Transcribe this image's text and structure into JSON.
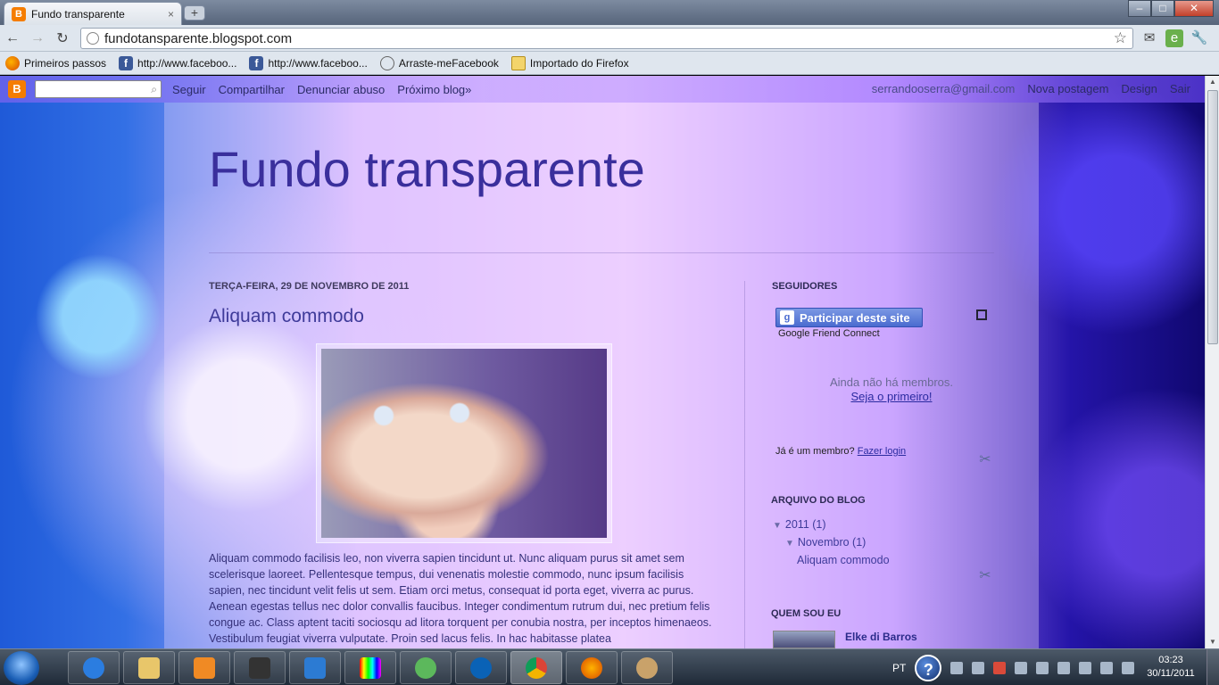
{
  "browser": {
    "tab_title": "Fundo transparente",
    "tab_close": "×",
    "new_tab": "+",
    "url": "fundotansparente.blogspot.com",
    "bookmarks": [
      {
        "label": "Primeiros passos",
        "icon": "firefox-icon"
      },
      {
        "label": "http://www.faceboo...",
        "icon": "facebook-icon"
      },
      {
        "label": "http://www.faceboo...",
        "icon": "facebook-icon"
      },
      {
        "label": "Arraste-meFacebook",
        "icon": "globe-icon"
      },
      {
        "label": "Importado do Firefox",
        "icon": "folder-icon"
      }
    ]
  },
  "navbar": {
    "links": [
      "Seguir",
      "Compartilhar",
      "Denunciar abuso",
      "Próximo blog»"
    ],
    "email": "serrandooserra@gmail.com",
    "right_links": [
      "Nova postagem",
      "Design",
      "Sair"
    ]
  },
  "blog": {
    "title": "Fundo transparente",
    "post": {
      "date": "TERÇA-FEIRA, 29 DE NOVEMBRO DE 2011",
      "title": "Aliquam commodo",
      "body": "Aliquam commodo facilisis leo, non viverra sapien tincidunt ut. Nunc aliquam purus sit amet sem scelerisque laoreet. Pellentesque tempus, dui venenatis molestie commodo, nunc ipsum facilisis sapien, nec tincidunt velit felis ut sem. Etiam orci metus, consequat id porta eget, viverra ac purus. Aenean egestas tellus nec dolor convallis faucibus. Integer condimentum rutrum dui, nec pretium felis congue ac. Class aptent taciti sociosqu ad litora torquent per conubia nostra, per inceptos himenaeos. Vestibulum feugiat viverra vulputate. Proin sed lacus felis. In hac habitasse platea"
    },
    "sidebar": {
      "followers_heading": "SEGUIDORES",
      "gfc_button": "Participar deste site",
      "gfc_sub": "Google Friend Connect",
      "members_empty": "Ainda não há membros.",
      "members_first": "Seja o primeiro!",
      "member_question": "Já é um membro?",
      "member_login": "Fazer login",
      "archive_heading": "ARQUIVO DO BLOG",
      "archive_year": "2011 (1)",
      "archive_month": "Novembro (1)",
      "archive_post": "Aliquam commodo",
      "about_heading": "QUEM SOU EU",
      "author_name": "Elke di Barros"
    }
  },
  "taskbar": {
    "lang": "PT",
    "time": "03:23",
    "date": "30/11/2011"
  }
}
